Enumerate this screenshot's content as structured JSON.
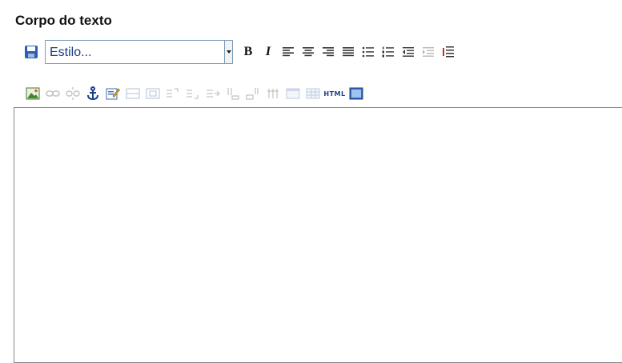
{
  "section": {
    "title": "Corpo do texto"
  },
  "toolbar": {
    "style_select": {
      "value": "Estilo..."
    },
    "bold_label": "B",
    "italic_label": "I",
    "row1_icons": [
      "save-icon",
      "bold",
      "italic",
      "align-left-icon",
      "align-center-icon",
      "align-right-icon",
      "align-justify-icon",
      "bullet-list-icon",
      "numbered-list-icon",
      "outdent-icon",
      "indent-icon-disabled",
      "indent-icon"
    ],
    "row2_icons": [
      "insert-image-icon",
      "link-icon",
      "unlink-icon",
      "anchor-icon",
      "edit-form-icon",
      "insert-row-icon",
      "table-cell-icon",
      "cell-merge-up-icon",
      "cell-merge-down-icon",
      "split-cell-icon",
      "row-above-icon",
      "row-below-icon",
      "delete-row-icon",
      "table-properties-icon",
      "table-icon",
      "html-source-icon",
      "fullscreen-icon"
    ],
    "html_badge": "HTML"
  },
  "editor": {
    "content": ""
  },
  "colors": {
    "title": "#111111",
    "select_text": "#1a3a8c",
    "select_border": "#7f9db9",
    "editor_border": "#888888"
  }
}
